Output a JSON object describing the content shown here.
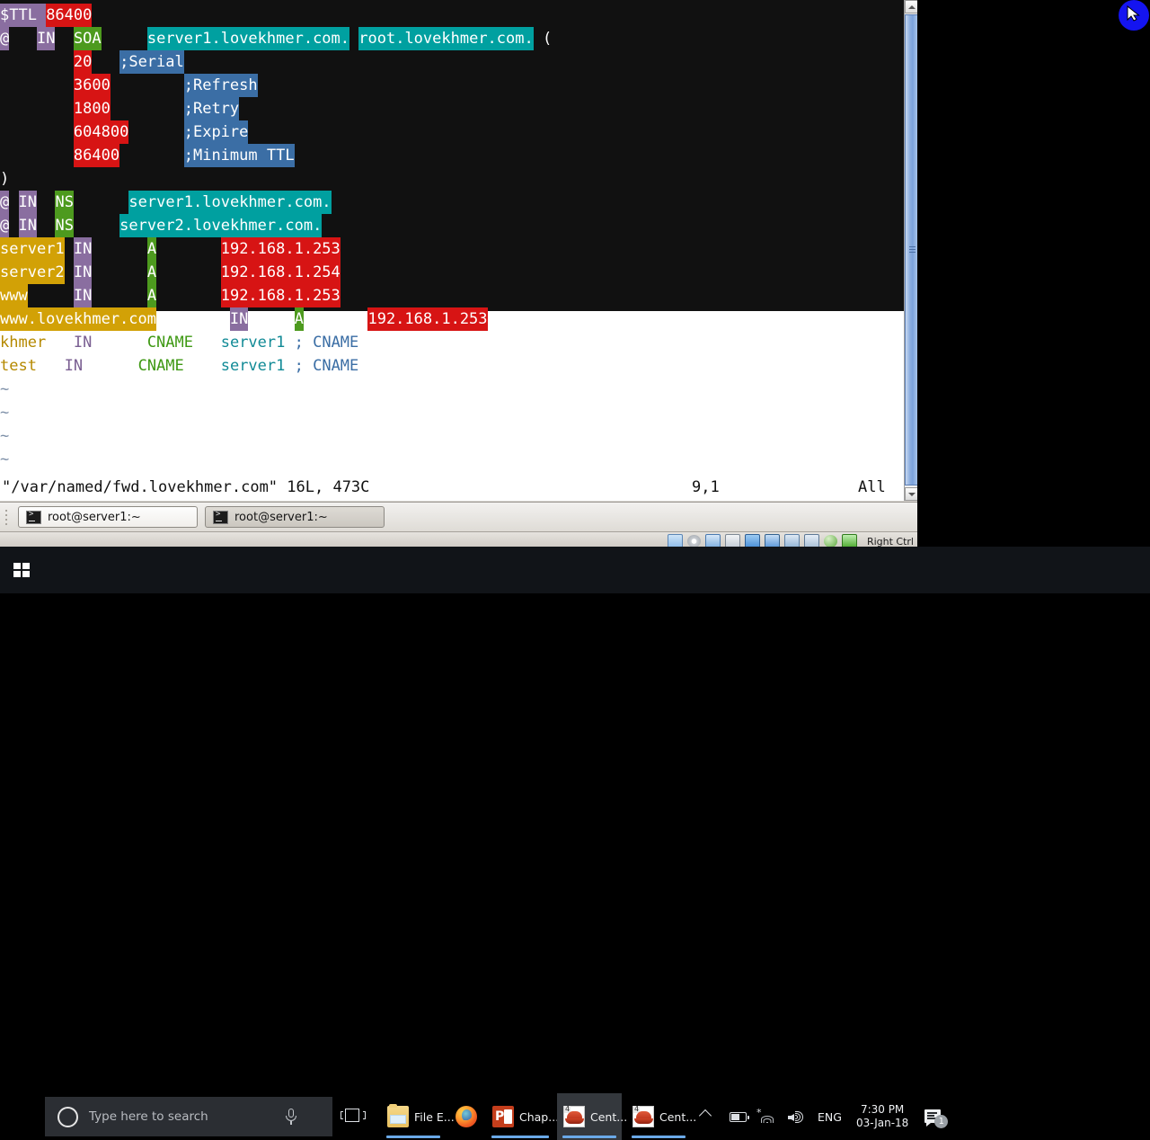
{
  "window": {
    "title": "root@server1:~",
    "scrollbar": {
      "present": true
    }
  },
  "terminal": {
    "editor": "vim",
    "file_lines": [
      {
        "id": 1,
        "segments": [
          {
            "text": "$TTL ",
            "style": "hl-purple"
          },
          {
            "text": "86400",
            "style": "hl-red"
          }
        ]
      },
      {
        "id": 2,
        "segments": [
          {
            "text": "@",
            "style": "hl-purple"
          },
          {
            "text": "   ",
            "style": "plain"
          },
          {
            "text": "IN",
            "style": "hl-purple"
          },
          {
            "text": "  ",
            "style": "plain"
          },
          {
            "text": "SOA",
            "style": "hl-green"
          },
          {
            "text": "     ",
            "style": "plain"
          },
          {
            "text": "server1.lovekhmer.com.",
            "style": "hl-teal"
          },
          {
            "text": " ",
            "style": "plain"
          },
          {
            "text": "root.lovekhmer.com.",
            "style": "hl-teal"
          },
          {
            "text": " (",
            "style": "plain"
          }
        ]
      },
      {
        "id": 3,
        "segments": [
          {
            "text": "        ",
            "style": "plain"
          },
          {
            "text": "20",
            "style": "hl-red"
          },
          {
            "text": "   ",
            "style": "plain"
          },
          {
            "text": ";Serial",
            "style": "hl-blue"
          }
        ]
      },
      {
        "id": 4,
        "segments": [
          {
            "text": "        ",
            "style": "plain"
          },
          {
            "text": "3600",
            "style": "hl-red"
          },
          {
            "text": "        ",
            "style": "plain"
          },
          {
            "text": ";Refresh",
            "style": "hl-blue"
          }
        ]
      },
      {
        "id": 5,
        "segments": [
          {
            "text": "        ",
            "style": "plain"
          },
          {
            "text": "1800",
            "style": "hl-red"
          },
          {
            "text": "        ",
            "style": "plain"
          },
          {
            "text": ";Retry",
            "style": "hl-blue"
          }
        ]
      },
      {
        "id": 6,
        "segments": [
          {
            "text": "        ",
            "style": "plain"
          },
          {
            "text": "604800",
            "style": "hl-red"
          },
          {
            "text": "      ",
            "style": "plain"
          },
          {
            "text": ";Expire",
            "style": "hl-blue"
          }
        ]
      },
      {
        "id": 7,
        "segments": [
          {
            "text": "        ",
            "style": "plain"
          },
          {
            "text": "86400",
            "style": "hl-red"
          },
          {
            "text": "       ",
            "style": "plain"
          },
          {
            "text": ";Minimum TTL",
            "style": "hl-blue"
          }
        ]
      },
      {
        "id": 8,
        "segments": [
          {
            "text": ")",
            "style": "plain"
          }
        ]
      },
      {
        "id": 9,
        "segments": [
          {
            "text": "@",
            "style": "hl-purple"
          },
          {
            "text": " ",
            "style": "plain"
          },
          {
            "text": "IN",
            "style": "hl-purple"
          },
          {
            "text": "  ",
            "style": "plain"
          },
          {
            "text": "NS",
            "style": "hl-green"
          },
          {
            "text": "      ",
            "style": "plain"
          },
          {
            "text": "server1.lovekhmer.com.",
            "style": "hl-teal"
          }
        ]
      },
      {
        "id": 10,
        "segments": [
          {
            "text": "@",
            "style": "hl-purple"
          },
          {
            "text": " ",
            "style": "plain"
          },
          {
            "text": "IN",
            "style": "hl-purple"
          },
          {
            "text": "  ",
            "style": "plain"
          },
          {
            "text": "NS",
            "style": "hl-green"
          },
          {
            "text": "     ",
            "style": "plain"
          },
          {
            "text": "server2.lovekhmer.com.",
            "style": "hl-teal"
          }
        ]
      },
      {
        "id": 11,
        "segments": [
          {
            "text": "server1",
            "style": "hl-gold"
          },
          {
            "text": " ",
            "style": "plain"
          },
          {
            "text": "IN",
            "style": "hl-purple"
          },
          {
            "text": "      ",
            "style": "plain"
          },
          {
            "text": "A",
            "style": "hl-green"
          },
          {
            "text": "       ",
            "style": "plain"
          },
          {
            "text": "192.168.1.253",
            "style": "hl-red"
          }
        ]
      },
      {
        "id": 12,
        "segments": [
          {
            "text": "server2",
            "style": "hl-gold"
          },
          {
            "text": " ",
            "style": "plain"
          },
          {
            "text": "IN",
            "style": "hl-purple"
          },
          {
            "text": "      ",
            "style": "plain"
          },
          {
            "text": "A",
            "style": "hl-green"
          },
          {
            "text": "       ",
            "style": "plain"
          },
          {
            "text": "192.168.1.254",
            "style": "hl-red"
          }
        ]
      },
      {
        "id": 13,
        "segments": [
          {
            "text": "www",
            "style": "hl-gold"
          },
          {
            "text": "     ",
            "style": "plain"
          },
          {
            "text": "IN",
            "style": "hl-purple"
          },
          {
            "text": "      ",
            "style": "plain"
          },
          {
            "text": "A",
            "style": "hl-green"
          },
          {
            "text": "       ",
            "style": "plain"
          },
          {
            "text": "192.168.1.253",
            "style": "hl-red"
          }
        ]
      },
      {
        "id": 14,
        "segments": [
          {
            "text": "www.lovekhmer.com",
            "style": "hl-gold"
          },
          {
            "text": "        ",
            "style": "plain"
          },
          {
            "text": "IN",
            "style": "hl-purple"
          },
          {
            "text": "     ",
            "style": "plain"
          },
          {
            "text": "A",
            "style": "hl-green"
          },
          {
            "text": "       ",
            "style": "plain"
          },
          {
            "text": "192.168.1.253",
            "style": "hl-red"
          }
        ]
      },
      {
        "id": 15,
        "segments": [
          {
            "text": "khmer",
            "style": "c-gold"
          },
          {
            "text": "   ",
            "style": "plain-k"
          },
          {
            "text": "IN",
            "style": "c-purple"
          },
          {
            "text": "      ",
            "style": "plain-k"
          },
          {
            "text": "CNAME",
            "style": "c-green"
          },
          {
            "text": "   ",
            "style": "plain-k"
          },
          {
            "text": "server1",
            "style": "c-teal"
          },
          {
            "text": " ",
            "style": "plain-k"
          },
          {
            "text": "; CNAME",
            "style": "c-blue"
          }
        ]
      },
      {
        "id": 16,
        "segments": [
          {
            "text": "test",
            "style": "c-gold"
          },
          {
            "text": "   ",
            "style": "plain-k"
          },
          {
            "text": "IN",
            "style": "c-purple"
          },
          {
            "text": "      ",
            "style": "plain-k"
          },
          {
            "text": "CNAME",
            "style": "c-green"
          },
          {
            "text": "    ",
            "style": "plain-k"
          },
          {
            "text": "server1",
            "style": "c-teal"
          },
          {
            "text": " ",
            "style": "plain-k"
          },
          {
            "text": "; CNAME",
            "style": "c-blue"
          }
        ]
      }
    ],
    "empty_markers": [
      "~",
      "~",
      "~",
      "~"
    ],
    "status": {
      "file": "\"/var/named/fwd.lovekhmer.com\" 16L, 473C",
      "position": "9,1",
      "scroll": "All"
    }
  },
  "tabs": [
    {
      "label": "root@server1:~",
      "active": true
    },
    {
      "label": "root@server1:~",
      "active": false
    }
  ],
  "vbox_status": {
    "host_key_label": "Right Ctrl",
    "icons": [
      "hard-disk-icon",
      "optical-disk-icon",
      "network-icon",
      "usb-icon",
      "shared-folder-icon",
      "display-icon",
      "remote-display-icon",
      "cpu-icon",
      "mouse-integration-icon",
      "host-key-icon"
    ]
  },
  "taskbar": {
    "start_label": "Start",
    "search_placeholder": "Type here to search",
    "task_view_label": "Task View",
    "apps": [
      {
        "label": "File E...",
        "icon": "file-explorer-icon",
        "active": false,
        "running": true
      },
      {
        "label": "",
        "icon": "firefox-icon",
        "active": false,
        "running": false
      },
      {
        "label": "Chap...",
        "icon": "powerpoint-icon",
        "active": false,
        "running": true
      },
      {
        "label": "Cent...",
        "icon": "virtualbox-centos-icon",
        "active": true,
        "running": true
      },
      {
        "label": "Cent...",
        "icon": "virtualbox-centos-icon",
        "active": false,
        "running": true
      }
    ],
    "tray": {
      "language": "ENG",
      "time": "7:30 PM",
      "date": "03-Jan-18",
      "notification_count": "1"
    }
  },
  "overlay": {
    "cursor_badge": "mouse-pointer-icon"
  },
  "colors": {
    "purple": "#8a6ea0",
    "red": "#d71414",
    "green": "#4d9a1e",
    "teal": "#00a0a0",
    "blue": "#3b6ea5",
    "gold": "#d2a106",
    "terminal_bg": "#111111",
    "taskbar_bg": "#111418",
    "accent": "#6aa9e8"
  }
}
